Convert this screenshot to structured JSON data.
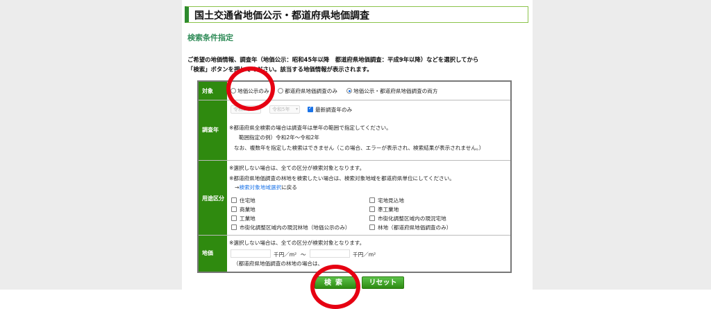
{
  "header": {
    "title": "国土交通省地価公示・都道府県地価調査"
  },
  "section_heading": "検索条件指定",
  "intro": {
    "line1": "ご希望の地価情報、調査年（地価公示：昭和45年以降　都道府県地価調査：平成9年以降）などを選択してから",
    "line2": "「検索」ボタンを押してください。該当する地価情報が表示されます。"
  },
  "form": {
    "target": {
      "label": "対象",
      "options": [
        "地価公示のみ",
        "都道府県地価調査のみ",
        "地価公示・都道府県地価調査の両方"
      ],
      "selected": "地価公示・都道府県地価調査の両方"
    },
    "year": {
      "label": "調査年",
      "from_value": "令和5年",
      "to_value": "令和5年",
      "latest_label": "最新調査年のみ",
      "latest_checked": true,
      "note1": "※都道府県全検索の場合は調査年は単年の範囲で指定してください。",
      "note2": "範囲指定の例）令和2年～令和2年",
      "note3": "なお、複数年を指定した検索はできません（この場合、エラーが表示され、検索結果が表示されません。）"
    },
    "usage": {
      "label": "用途区分",
      "note1": "※選択しない場合は、全ての区分が検索対象となります。",
      "note2": "※都道府県地価調査の林地を検索したい場合は、検索対象地域を都道府県単位にしてください。",
      "link_prefix": "→",
      "link_text": "検索対象地域選択",
      "link_suffix": "に戻る",
      "left_items": [
        "住宅地",
        "商業地",
        "工業地",
        "市街化調整区域内の現況林地（地価公示のみ）"
      ],
      "right_items": [
        "宅地見込地",
        "準工業地",
        "市街化調整区域内の現況宅地",
        "林地（都道府県地価調査のみ）"
      ]
    },
    "price": {
      "label": "地価",
      "note": "※選択しない場合は、全ての区分が検索対象となります。",
      "unit1": "千円／m²",
      "tilde": "～",
      "unit2": "千円／m²",
      "note2": "（都道府県地価調査の林地の場合は、"
    }
  },
  "buttons": {
    "search": "検索",
    "reset": "リセット"
  },
  "colors": {
    "green": "#2f8a0f",
    "annotation_red": "#e60012",
    "link_blue": "#1a73e8"
  }
}
